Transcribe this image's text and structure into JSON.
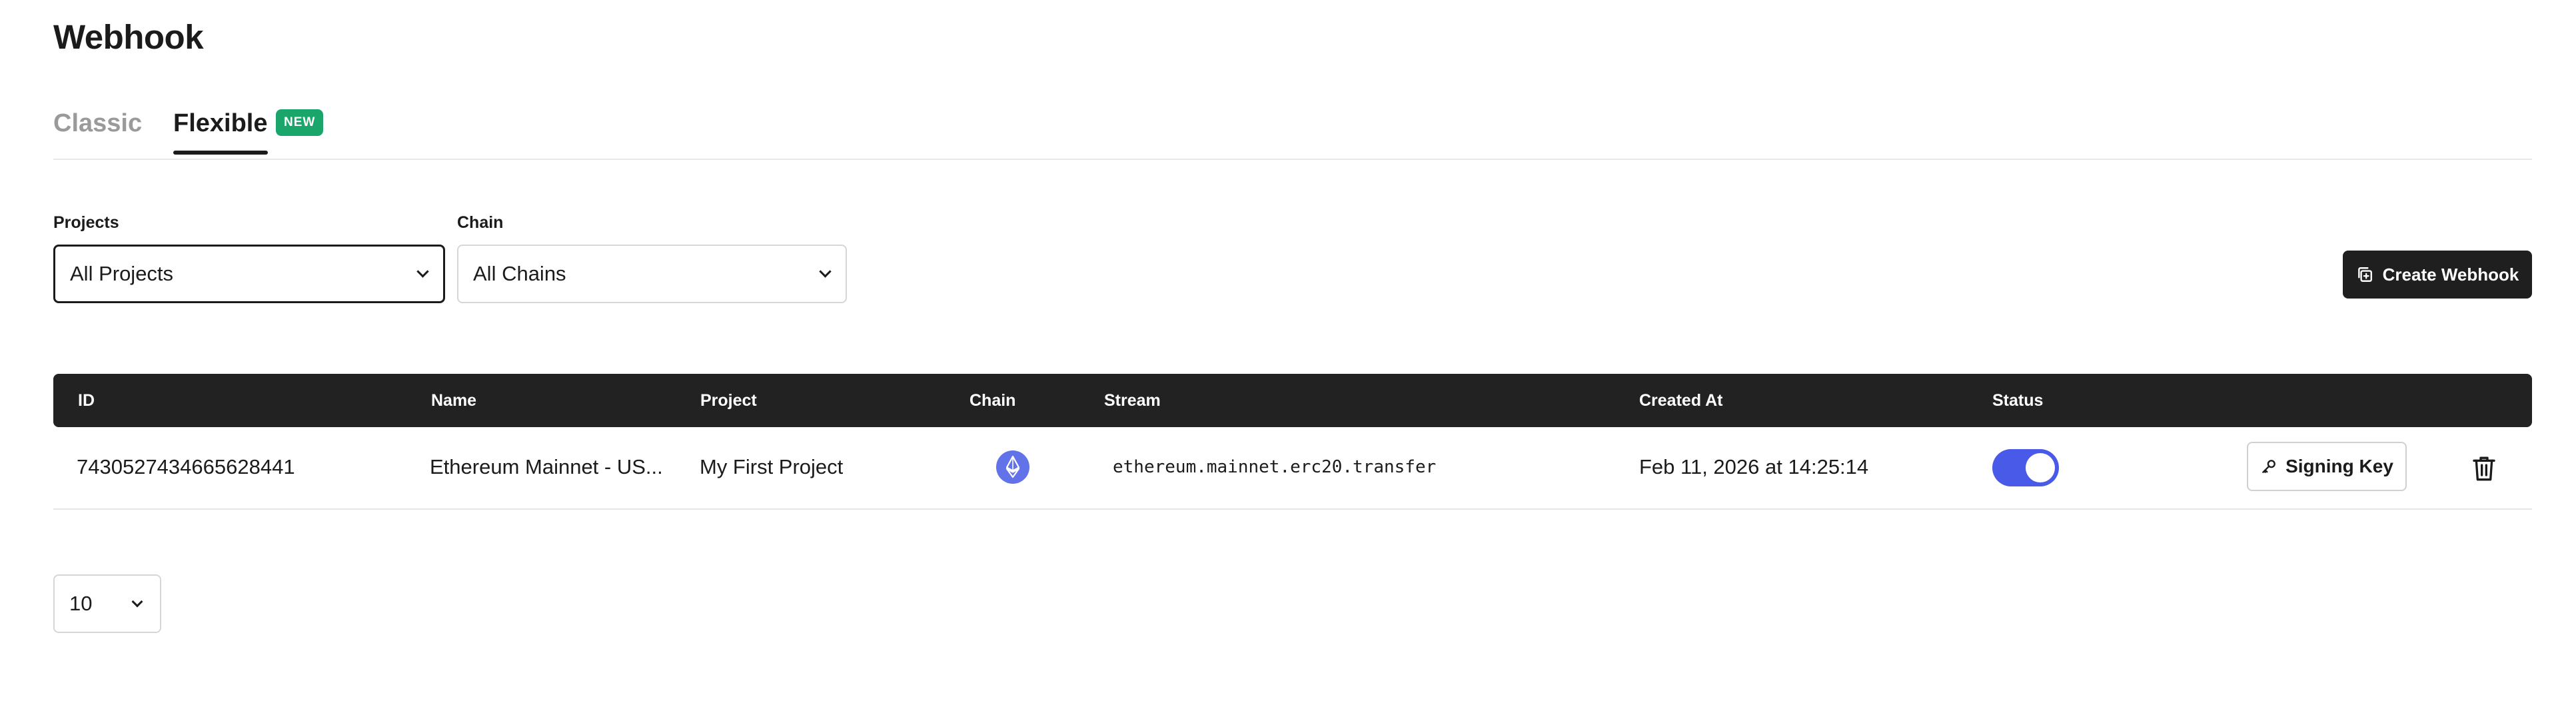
{
  "page": {
    "title": "Webhook"
  },
  "tabs": [
    {
      "label": "Classic",
      "active": false
    },
    {
      "label": "Flexible",
      "active": true,
      "badge": "NEW"
    }
  ],
  "filters": {
    "projects": {
      "label": "Projects",
      "value": "All Projects"
    },
    "chain": {
      "label": "Chain",
      "value": "All Chains"
    }
  },
  "actions": {
    "create_label": "Create Webhook",
    "create_icon": "copy-plus-icon"
  },
  "table": {
    "columns": [
      "ID",
      "Name",
      "Project",
      "Chain",
      "Stream",
      "Created At",
      "Status"
    ],
    "rows": [
      {
        "id": "7430527434665628441",
        "name": "Ethereum Mainnet - US...",
        "project": "My First Project",
        "chain_icon": "ethereum-icon",
        "stream": "ethereum.mainnet.erc20.transfer",
        "created_at": "Feb 11, 2026 at 14:25:14",
        "status_enabled": true,
        "signing_label": "Signing Key",
        "signing_icon": "key-icon",
        "delete_icon": "trash-icon"
      }
    ]
  },
  "pagination": {
    "page_size": "10"
  },
  "colors": {
    "accent": "#4a5ae8",
    "badge": "#1aa66b",
    "header_bg": "#222222",
    "eth": "#6272e8"
  }
}
